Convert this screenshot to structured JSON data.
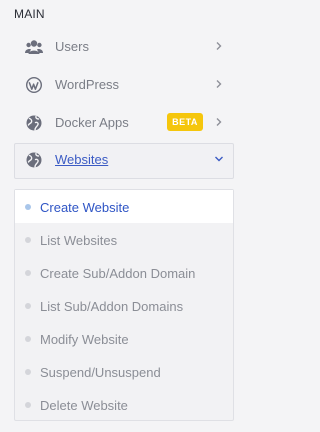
{
  "sidebar": {
    "section_title": "MAIN",
    "items": [
      {
        "label": "Users",
        "icon": "users-icon"
      },
      {
        "label": "WordPress",
        "icon": "wordpress-icon"
      },
      {
        "label": "Docker Apps",
        "icon": "globe-icon",
        "badge": "BETA"
      },
      {
        "label": "Websites",
        "icon": "globe-icon",
        "expanded": true
      }
    ],
    "submenu": [
      {
        "label": "Create Website",
        "selected": true
      },
      {
        "label": "List Websites"
      },
      {
        "label": "Create Sub/Addon Domain"
      },
      {
        "label": "List Sub/Addon Domains"
      },
      {
        "label": "Modify Website"
      },
      {
        "label": "Suspend/Unsuspend"
      },
      {
        "label": "Delete Website"
      }
    ]
  },
  "colors": {
    "background": "#f4f4f6",
    "icon": "#6b6e7c",
    "link_active": "#3b5bc4",
    "badge": "#f5c60c",
    "selected_dot": "#a9c6ea"
  }
}
